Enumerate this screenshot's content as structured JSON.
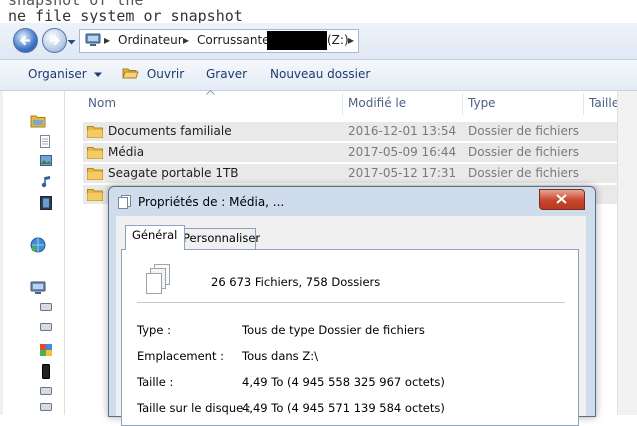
{
  "background_text": {
    "line1": "snapshot of the",
    "line2": "ne file system or snapshot"
  },
  "breadcrumb": {
    "items": [
      "Ordinateur",
      "Corrussante",
      "(Z:)"
    ],
    "separator": "▸"
  },
  "toolbar": {
    "organize": "Organiser",
    "open": "Ouvrir",
    "burn": "Graver",
    "new_folder": "Nouveau dossier"
  },
  "columns": {
    "name": "Nom",
    "modified": "Modifié le",
    "type": "Type",
    "size": "Taille"
  },
  "files": [
    {
      "name": "Documents familiale",
      "modified": "2016-12-01 13:54",
      "type": "Dossier de fichiers"
    },
    {
      "name": "Média",
      "modified": "2017-05-09 16:44",
      "type": "Dossier de fichiers"
    },
    {
      "name": "Seagate portable 1TB",
      "modified": "2017-05-12 17:31",
      "type": "Dossier de fichiers"
    }
  ],
  "dialog": {
    "title": "Propriétés de : Média, ...",
    "tabs": [
      "Général",
      "Personnaliser"
    ],
    "summary": "26 673 Fichiers, 758 Dossiers",
    "fields": [
      {
        "label": "Type :",
        "value": "Tous de type Dossier de fichiers"
      },
      {
        "label": "Emplacement :",
        "value": "Tous dans Z:\\"
      },
      {
        "label": "Taille :",
        "value": "4,49 To (4 945 558 325 967 octets)"
      },
      {
        "label": "Taille sur le disque :",
        "value": "4,49 To (4 945 571 139 584 octets)"
      }
    ]
  },
  "colors": {
    "folder": "#e8b740",
    "row_highlight": "#e9e9e9",
    "close_button": "#c7452a",
    "link_text": "#1e3a6e"
  },
  "icons": [
    "back-arrow-icon",
    "forward-arrow-icon",
    "computer-icon",
    "chevron-down-icon",
    "folder-icon",
    "open-folder-icon",
    "close-icon",
    "files-stack-icon"
  ]
}
